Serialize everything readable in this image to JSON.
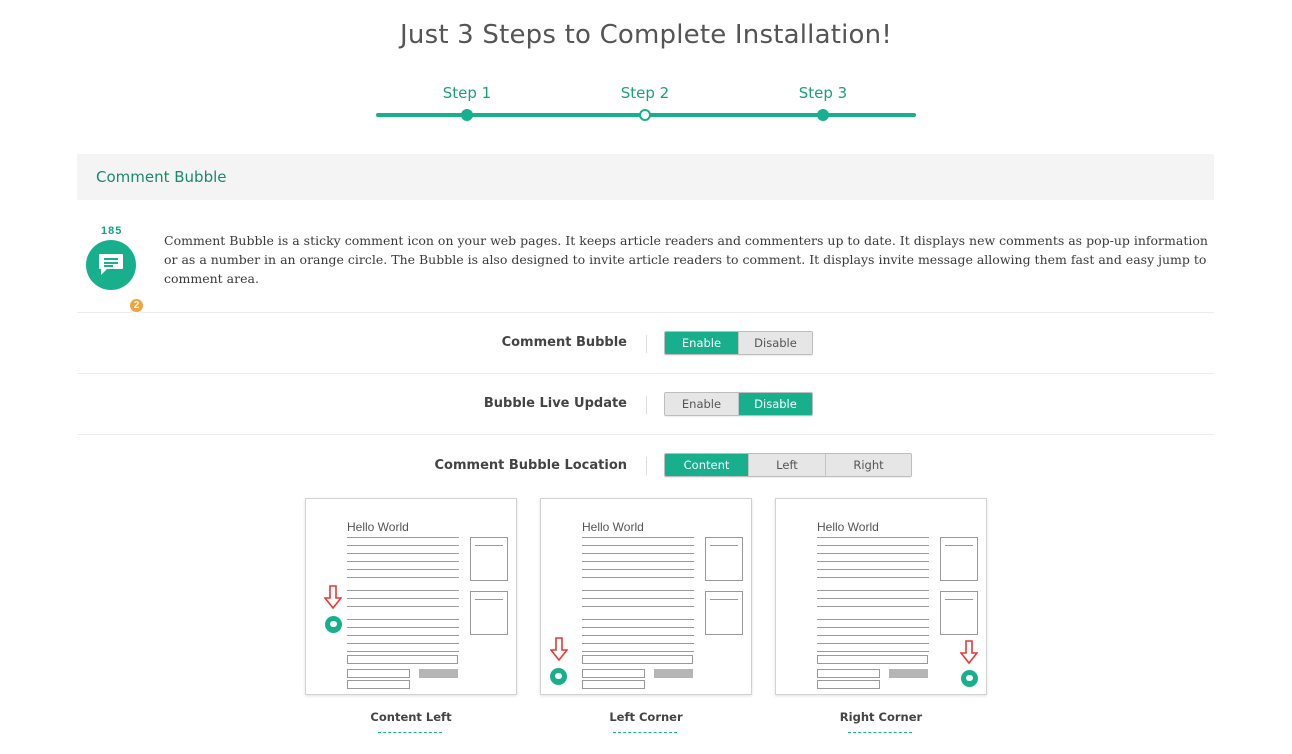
{
  "page": {
    "title": "Just 3 Steps to Complete Installation!"
  },
  "steps": [
    {
      "label": "Step 1",
      "state": "done"
    },
    {
      "label": "Step 2",
      "state": "current"
    },
    {
      "label": "Step 3",
      "state": "done"
    }
  ],
  "section": {
    "title": "Comment Bubble",
    "icon": "comment-bubble-icon",
    "comment_count": "185",
    "badge_count": "2",
    "description": "Comment Bubble is a sticky comment icon on your web pages. It keeps article readers and commenters up to date. It displays new comments as pop-up information or as a number in an orange circle. The Bubble is also designed to invite article readers to comment. It displays invite message allowing them fast and easy jump to comment area."
  },
  "settings": [
    {
      "label": "Comment Bubble",
      "options": [
        "Enable",
        "Disable"
      ],
      "selected": "Enable"
    },
    {
      "label": "Bubble Live Update",
      "options": [
        "Enable",
        "Disable"
      ],
      "selected": "Disable"
    },
    {
      "label": "Comment Bubble Location",
      "options": [
        "Content Left",
        "Left Corner",
        "Right Corner"
      ],
      "selected": "Content Left"
    }
  ],
  "location_previews": [
    {
      "label": "Content Left",
      "preview_title": "Hello World"
    },
    {
      "label": "Left Corner",
      "preview_title": "Hello World"
    },
    {
      "label": "Right Corner",
      "preview_title": "Hello World"
    }
  ],
  "colors": {
    "accent": "#18b08c",
    "badge": "#f2a33a",
    "arrow": "#e53935"
  }
}
